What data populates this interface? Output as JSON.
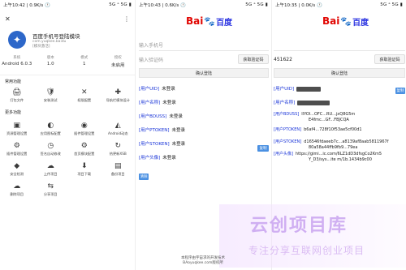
{
  "panel1": {
    "statusbar": {
      "left": "上午10:42 | 0.9K/s 🕐",
      "right": "5G ᵃ 5G ▮"
    },
    "header": {
      "close_icon": "close-icon",
      "more_icon": "more-icon"
    },
    "app": {
      "name": "百度手机号登陆模块",
      "package": "com.yuqkee.baidu",
      "sub": "[模块激活]"
    },
    "stats": [
      {
        "key": "系统",
        "value": "Android 6.0.3"
      },
      {
        "key": "版本",
        "value": "1.0"
      },
      {
        "key": "模式",
        "value": "1"
      },
      {
        "key": "授权",
        "value": "未启用"
      }
    ],
    "section1": "常用功能",
    "grid1": [
      {
        "icon": "print-icon",
        "glyph": "🖨",
        "label": "打包文件"
      },
      {
        "icon": "shield-icon",
        "glyph": "🛡",
        "label": "安装测试"
      },
      {
        "icon": "tools-icon",
        "glyph": "✕",
        "label": "权限配置"
      },
      {
        "icon": "puzzle-icon",
        "glyph": "✚",
        "label": "导航栏模块设计"
      }
    ],
    "section2": "更多功能",
    "grid2": [
      {
        "icon": "box-icon",
        "glyph": "▣",
        "label": "资源管理设置"
      },
      {
        "icon": "palette-icon",
        "glyph": "◐",
        "label": "应用图标配置"
      },
      {
        "icon": "gamepad-icon",
        "glyph": "◉",
        "label": "插件管理设置"
      },
      {
        "icon": "android-icon",
        "glyph": "◭",
        "label": "Android动态"
      },
      {
        "icon": "settings-icon",
        "glyph": "⚙",
        "label": "插件管理设置"
      },
      {
        "icon": "history-icon",
        "glyph": "◷",
        "label": "签名自动修改"
      },
      {
        "icon": "gear-icon",
        "glyph": "⚙",
        "label": "首页模块配置"
      },
      {
        "icon": "refresh-icon",
        "glyph": "↻",
        "label": "热更新XSB"
      },
      {
        "icon": "security-icon",
        "glyph": "◆",
        "label": "安全检测"
      },
      {
        "icon": "cloud-up-icon",
        "glyph": "☁",
        "label": "上传项目"
      },
      {
        "icon": "download-icon",
        "glyph": "⬇",
        "label": "项目下载"
      },
      {
        "icon": "backup-icon",
        "glyph": "▤",
        "label": "备份项目"
      },
      {
        "icon": "cloud-icon",
        "glyph": "☁",
        "label": "删除项目"
      },
      {
        "icon": "share-icon",
        "glyph": "⇆",
        "label": "分享项目"
      }
    ]
  },
  "panel2": {
    "statusbar": {
      "left": "上午10:43 | 0.6K/s 🕐",
      "right": "5G ᵃ 5G ▮"
    },
    "logo": {
      "text": "Bai",
      "paw": "🐾",
      "cn": "百度"
    },
    "phone_placeholder": "输入手机号",
    "code_placeholder": "输入验证码",
    "get_code": "获取验证码",
    "login": "确认登陆",
    "rows": [
      {
        "label": "[用户UID]",
        "value": "未登录"
      },
      {
        "label": "[用户名称]",
        "value": "未登录"
      },
      {
        "label": "[用户BDUSS]",
        "value": "未登录"
      },
      {
        "label": "[用户PTOKEN]",
        "value": "未登录"
      },
      {
        "label": "[用户STOKEN]",
        "value": "未登录"
      },
      {
        "label": "[用户头像]",
        "value": "未登录"
      }
    ],
    "copy_btn": "复制",
    "clear_btn": "清除",
    "footer": [
      "本程序由宇宙求的开发技术",
      "BAoyuqkee.com版权所"
    ]
  },
  "panel3": {
    "statusbar": {
      "left": "上午10:35 | 0.0K/s 🕐",
      "right": "5G ᵃ 5G ▮"
    },
    "phone_value": "",
    "code_value": "451622",
    "get_code": "获取验证码",
    "login": "确认登陆",
    "rows": [
      {
        "label": "[用户UID]",
        "value": ""
      },
      {
        "label": "[用户名称]",
        "value": ""
      },
      {
        "label": "[用户BDUSS]",
        "value": "IlYOl...OFC...RU...jxQ8G5m"
      },
      {
        "label": "",
        "value": "E4fmc...GF...FBJCQA"
      },
      {
        "label": "[用户PTOKEN]",
        "value": "b6af4...728f10f53ae5cf00d1"
      },
      {
        "label": "[用户STOKEN]",
        "value": "d16546fdaeeb7c...a8139af8aab5811967f"
      },
      {
        "label": "",
        "value": "80a58a44ffb9fb9...79ea"
      },
      {
        "label": "[用户头像]",
        "value": "https://gimi...ic.com/6LZ1dD3dfsgCo2Km5"
      },
      {
        "label": "",
        "value": "Y_D3/sys...ite m/1b.1434b9c00"
      }
    ],
    "copy_btn": "复制"
  },
  "watermark": {
    "big": "云创项目库",
    "small": "专注分享互联网创业项目"
  }
}
